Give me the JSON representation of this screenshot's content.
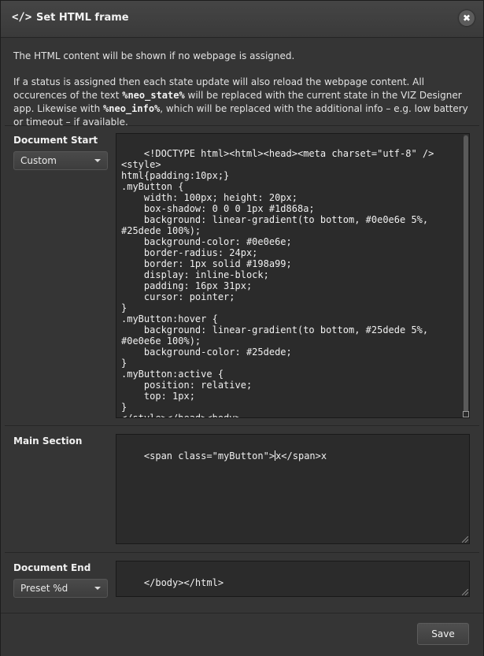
{
  "dialog": {
    "title_icon": "</>",
    "title": "Set HTML frame",
    "close_icon": "✖"
  },
  "info": {
    "line1": "The HTML content will be shown if no webpage is assigned.",
    "line2_part1": "If a status is assigned then each state update will also reload the webpage content. All occurences of the text ",
    "token_state": "%neo_state%",
    "line2_part2": " will be replaced with the current state in the VIZ Designer app. Likewise with ",
    "token_info": "%neo_info%",
    "line2_part3": ", which will be replaced with the additional info – e.g. low battery or timeout – if available."
  },
  "document_start": {
    "label": "Document Start",
    "select_value": "Custom",
    "code": "<!DOCTYPE html><html><head><meta charset=\"utf-8\" />\n<style>\nhtml{padding:10px;}\n.myButton {\n    width: 100px; height: 20px;\n    box-shadow: 0 0 0 1px #1d868a;\n    background: linear-gradient(to bottom, #0e0e6e 5%,\n#25dede 100%);\n    background-color: #0e0e6e;\n    border-radius: 24px;\n    border: 1px solid #198a99;\n    display: inline-block;\n    padding: 16px 31px;\n    cursor: pointer;\n}\n.myButton:hover {\n    background: linear-gradient(to bottom, #25dede 5%,\n#0e0e6e 100%);\n    background-color: #25dede;\n}\n.myButton:active {\n    position: relative;\n    top: 1px;\n}\n</style></head><body>"
  },
  "main_section": {
    "label": "Main Section",
    "code_before_cursor": "<span class=\"myButton\">",
    "code_after_cursor": "x</span>x"
  },
  "document_end": {
    "label": "Document End",
    "select_value": "Preset %d",
    "code": "</body></html>"
  },
  "footer": {
    "save_label": "Save"
  }
}
